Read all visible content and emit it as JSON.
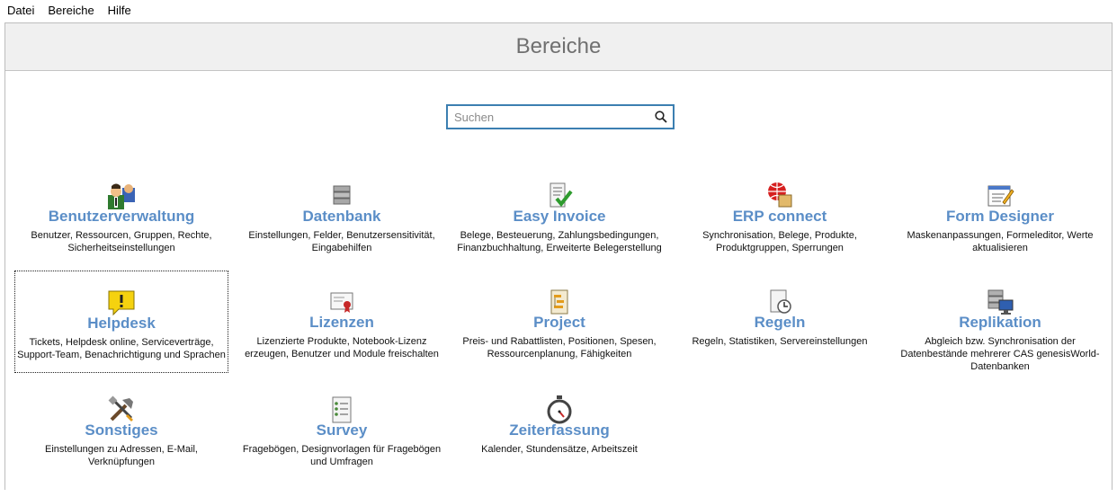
{
  "menu": {
    "items": [
      "Datei",
      "Bereiche",
      "Hilfe"
    ]
  },
  "header": {
    "title": "Bereiche"
  },
  "search": {
    "placeholder": "Suchen"
  },
  "tiles": [
    {
      "title": "Benutzerverwaltung",
      "desc": "Benutzer, Ressourcen, Gruppen, Rechte, Sicherheitseinstellungen",
      "icon": "users-icon"
    },
    {
      "title": "Datenbank",
      "desc": "Einstellungen, Felder, Benutzersensitivität, Eingabehilfen",
      "icon": "database-icon"
    },
    {
      "title": "Easy Invoice",
      "desc": "Belege, Besteuerung, Zahlungsbedingungen, Finanzbuchhaltung, Erweiterte Belegerstellung",
      "icon": "invoice-check-icon"
    },
    {
      "title": "ERP connect",
      "desc": "Synchronisation, Belege, Produkte, Produktgruppen, Sperrungen",
      "icon": "erp-globe-icon"
    },
    {
      "title": "Form Designer",
      "desc": "Maskenanpassungen, Formeleditor, Werte aktualisieren",
      "icon": "form-pencil-icon"
    },
    {
      "title": "Helpdesk",
      "desc": "Tickets, Helpdesk online, Serviceverträge, Support-Team, Benachrichtigung und Sprachen",
      "icon": "alert-bubble-icon"
    },
    {
      "title": "Lizenzen",
      "desc": "Lizenzierte Produkte, Notebook-Lizenz erzeugen, Benutzer und Module freischalten",
      "icon": "certificate-icon"
    },
    {
      "title": "Project",
      "desc": "Preis- und Rabattlisten, Positionen, Spesen, Ressourcenplanung, Fähigkeiten",
      "icon": "project-icon"
    },
    {
      "title": "Regeln",
      "desc": "Regeln, Statistiken, Servereinstellungen",
      "icon": "rules-clock-icon"
    },
    {
      "title": "Replikation",
      "desc": "Abgleich bzw. Synchronisation der Datenbestände mehrerer CAS genesisWorld-Datenbanken",
      "icon": "server-monitor-icon"
    },
    {
      "title": "Sonstiges",
      "desc": "Einstellungen zu Adressen, E-Mail, Verknüpfungen",
      "icon": "tools-icon"
    },
    {
      "title": "Survey",
      "desc": "Fragebögen, Designvorlagen für Fragebögen und Umfragen",
      "icon": "checklist-icon"
    },
    {
      "title": "Zeiterfassung",
      "desc": "Kalender, Stundensätze, Arbeitszeit",
      "icon": "stopwatch-icon"
    }
  ],
  "colors": {
    "title": "#5b8ec7",
    "searchBorder": "#3c7fb1",
    "headerBg": "#f0f0f0"
  }
}
